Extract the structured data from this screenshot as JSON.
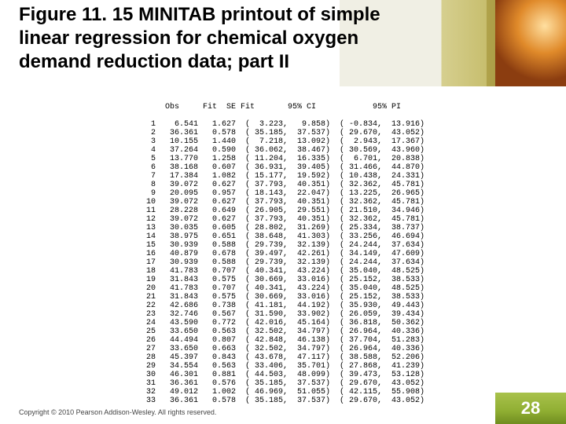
{
  "title": "Figure 11. 15  MINITAB printout of simple linear regression for chemical oxygen demand reduction data; part II",
  "copyright": "Copyright © 2010 Pearson Addison-Wesley. All rights reserved.",
  "page_number": "28",
  "chart_data": {
    "type": "table",
    "title": "MINITAB simple linear regression output (part II)",
    "columns": [
      "Obs",
      "Fit",
      "SE Fit",
      "95% CI low",
      "95% CI high",
      "95% PI low",
      "95% PI high"
    ],
    "rows": [
      [
        1,
        6.541,
        1.627,
        3.223,
        9.858,
        -0.834,
        13.916
      ],
      [
        2,
        36.361,
        0.578,
        35.185,
        37.537,
        29.67,
        43.052
      ],
      [
        3,
        10.155,
        1.44,
        7.218,
        13.092,
        2.943,
        17.367
      ],
      [
        4,
        37.264,
        0.59,
        36.062,
        38.467,
        30.569,
        43.96
      ],
      [
        5,
        13.77,
        1.258,
        11.204,
        16.335,
        6.701,
        20.838
      ],
      [
        6,
        38.168,
        0.607,
        36.931,
        39.405,
        31.466,
        44.87
      ],
      [
        7,
        17.384,
        1.082,
        15.177,
        19.592,
        10.438,
        24.331
      ],
      [
        8,
        39.072,
        0.627,
        37.793,
        40.351,
        32.362,
        45.781
      ],
      [
        9,
        20.095,
        0.957,
        18.143,
        22.047,
        13.225,
        26.965
      ],
      [
        10,
        39.072,
        0.627,
        37.793,
        40.351,
        32.362,
        45.781
      ],
      [
        11,
        28.228,
        0.649,
        26.905,
        29.551,
        21.51,
        34.946
      ],
      [
        12,
        39.072,
        0.627,
        37.793,
        40.351,
        32.362,
        45.781
      ],
      [
        13,
        30.035,
        0.605,
        28.802,
        31.269,
        25.334,
        38.737
      ],
      [
        14,
        38.975,
        0.651,
        38.648,
        41.303,
        33.256,
        46.694
      ],
      [
        15,
        30.939,
        0.588,
        29.739,
        32.139,
        24.244,
        37.634
      ],
      [
        16,
        40.879,
        0.678,
        39.497,
        42.261,
        34.149,
        47.609
      ],
      [
        17,
        30.939,
        0.588,
        29.739,
        32.139,
        24.244,
        37.634
      ],
      [
        18,
        41.783,
        0.707,
        40.341,
        43.224,
        35.04,
        48.525
      ],
      [
        19,
        31.843,
        0.575,
        30.669,
        33.016,
        25.152,
        38.533
      ],
      [
        20,
        41.783,
        0.707,
        40.341,
        43.224,
        35.04,
        48.525
      ],
      [
        21,
        31.843,
        0.575,
        30.669,
        33.016,
        25.152,
        38.533
      ],
      [
        22,
        42.686,
        0.738,
        41.181,
        44.192,
        35.93,
        49.443
      ],
      [
        23,
        32.746,
        0.567,
        31.59,
        33.902,
        26.059,
        39.434
      ],
      [
        24,
        43.59,
        0.772,
        42.016,
        45.164,
        36.818,
        50.362
      ],
      [
        25,
        33.65,
        0.563,
        32.502,
        34.797,
        26.964,
        40.336
      ],
      [
        26,
        44.494,
        0.807,
        42.848,
        46.138,
        37.704,
        51.283
      ],
      [
        27,
        33.65,
        0.663,
        32.502,
        34.797,
        26.964,
        40.336
      ],
      [
        28,
        45.397,
        0.843,
        43.678,
        47.117,
        38.588,
        52.206
      ],
      [
        29,
        34.554,
        0.563,
        33.406,
        35.701,
        27.868,
        41.239
      ],
      [
        30,
        46.301,
        0.881,
        44.503,
        48.099,
        39.473,
        53.128
      ],
      [
        31,
        36.361,
        0.576,
        35.185,
        37.537,
        29.67,
        43.052
      ],
      [
        32,
        49.012,
        1.002,
        46.969,
        51.055,
        42.115,
        55.908
      ],
      [
        33,
        36.361,
        0.578,
        35.185,
        37.537,
        29.67,
        43.052
      ]
    ]
  },
  "printout_header": "Obs     Fit  SE Fit       95% CI            95% PI"
}
